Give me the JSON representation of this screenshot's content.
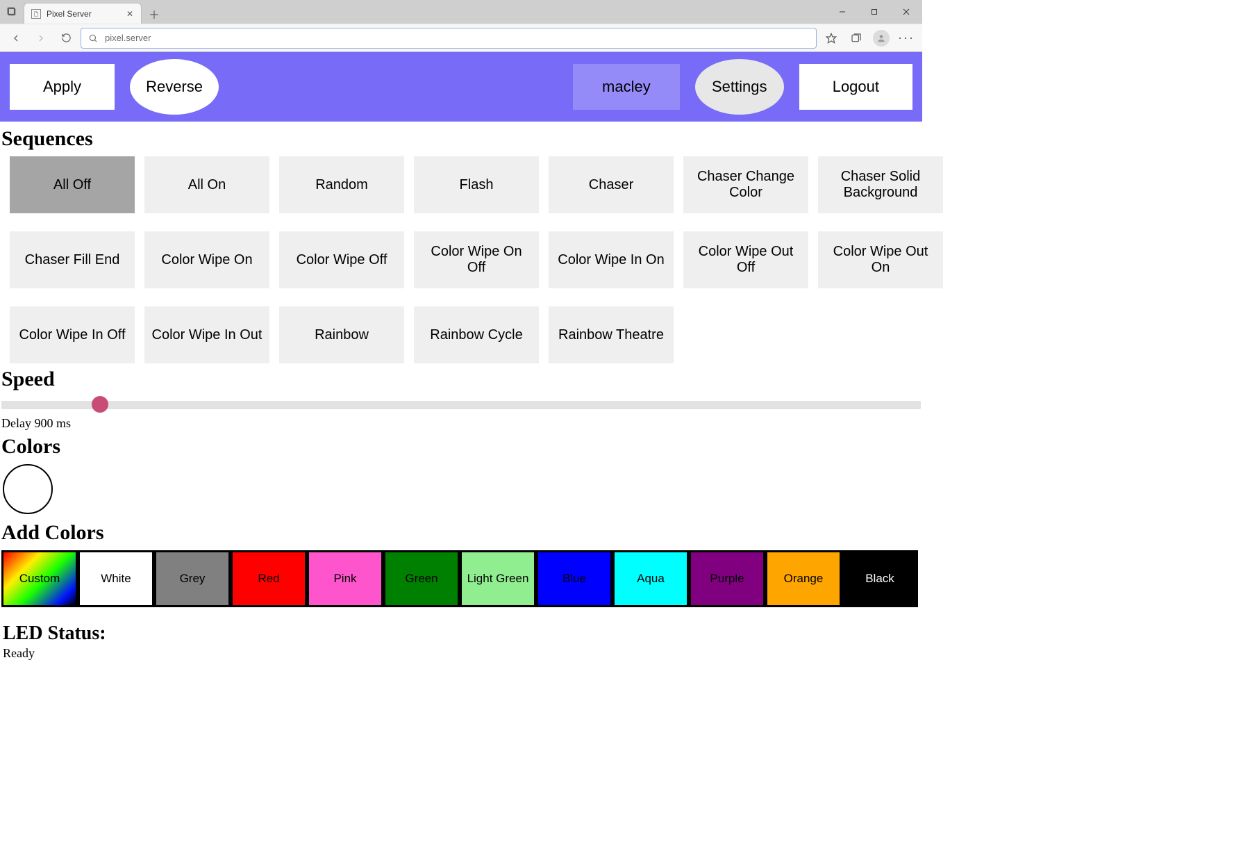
{
  "browser": {
    "tab_title": "Pixel Server",
    "url": "pixel.server"
  },
  "header": {
    "apply_label": "Apply",
    "reverse_label": "Reverse",
    "username": "macley",
    "settings_label": "Settings",
    "logout_label": "Logout"
  },
  "sections": {
    "sequences": "Sequences",
    "speed": "Speed",
    "colors": "Colors",
    "add_colors": "Add Colors",
    "led_status": "LED Status:"
  },
  "sequences": [
    {
      "label": "All Off",
      "selected": true
    },
    {
      "label": "All On",
      "selected": false
    },
    {
      "label": "Random",
      "selected": false
    },
    {
      "label": "Flash",
      "selected": false
    },
    {
      "label": "Chaser",
      "selected": false
    },
    {
      "label": "Chaser Change Color",
      "selected": false
    },
    {
      "label": "Chaser Solid Background",
      "selected": false
    },
    {
      "label": "Chaser Fill End",
      "selected": false
    },
    {
      "label": "Color Wipe On",
      "selected": false
    },
    {
      "label": "Color Wipe Off",
      "selected": false
    },
    {
      "label": "Color Wipe On Off",
      "selected": false
    },
    {
      "label": "Color Wipe In On",
      "selected": false
    },
    {
      "label": "Color Wipe Out Off",
      "selected": false
    },
    {
      "label": "Color Wipe Out On",
      "selected": false
    },
    {
      "label": "Color Wipe In Off",
      "selected": false
    },
    {
      "label": "Color Wipe In Out",
      "selected": false
    },
    {
      "label": "Rainbow",
      "selected": false
    },
    {
      "label": "Rainbow Cycle",
      "selected": false
    },
    {
      "label": "Rainbow Theatre",
      "selected": false
    }
  ],
  "speed": {
    "delay_text": "Delay 900 ms"
  },
  "current_colors": [
    {
      "hex": "#ffffff"
    }
  ],
  "palette": [
    {
      "label": "Custom",
      "class": "pal-custom"
    },
    {
      "label": "White",
      "class": "pal-white"
    },
    {
      "label": "Grey",
      "class": "pal-grey"
    },
    {
      "label": "Red",
      "class": "pal-red"
    },
    {
      "label": "Pink",
      "class": "pal-pink"
    },
    {
      "label": "Green",
      "class": "pal-green"
    },
    {
      "label": "Light Green",
      "class": "pal-lightgreen"
    },
    {
      "label": "Blue",
      "class": "pal-blue"
    },
    {
      "label": "Aqua",
      "class": "pal-aqua"
    },
    {
      "label": "Purple",
      "class": "pal-purple"
    },
    {
      "label": "Orange",
      "class": "pal-orange"
    },
    {
      "label": "Black",
      "class": "pal-black"
    }
  ],
  "status": {
    "text": "Ready"
  }
}
